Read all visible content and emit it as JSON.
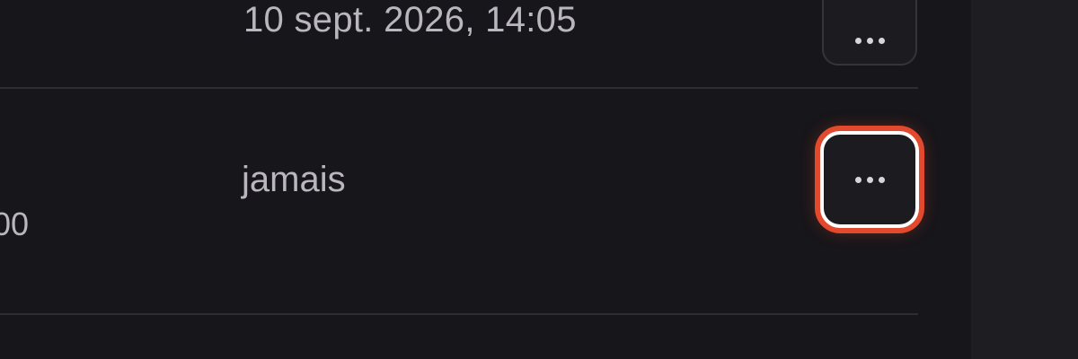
{
  "rows": [
    {
      "last_used": "10 sept. 2026, 14:05",
      "actions_icon": "more-horizontal-icon"
    },
    {
      "last_used": "jamais",
      "partial_text": "00",
      "actions_icon": "more-horizontal-icon",
      "highlighted": true
    }
  ],
  "colors": {
    "background": "#17161a",
    "side_panel": "#1e1d22",
    "text": "#b9b7bd",
    "divider": "#2e2d33",
    "highlight_ring": "#e2492d"
  }
}
